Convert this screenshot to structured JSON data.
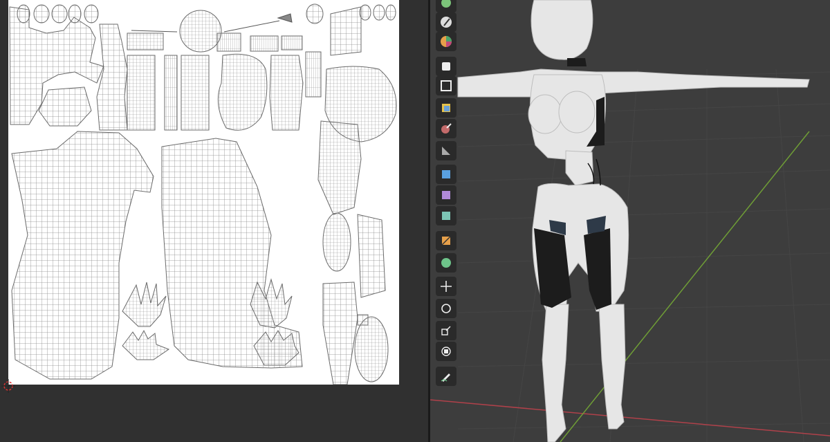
{
  "uv_editor": {
    "canvas_color": "#ffffff",
    "wire_color": "#8a8a8a",
    "background_color": "#303030"
  },
  "viewport": {
    "background_color": "#3d3d3d",
    "x_axis_color": "#b0414a",
    "y_axis_color": "#6f9e36",
    "model_color": "#e6e6e6"
  },
  "toolbar": {
    "tools": [
      {
        "name": "shader-smooth",
        "icon": "sphere-icon"
      },
      {
        "name": "paint-brush",
        "icon": "paint-brush-icon"
      },
      {
        "name": "paint-color",
        "icon": "color-wheel-icon"
      },
      {
        "name": "draw",
        "icon": "draw-icon"
      },
      {
        "name": "layer",
        "icon": "layer-icon"
      },
      {
        "name": "fill",
        "icon": "fill-icon"
      },
      {
        "name": "sample",
        "icon": "eyedropper-icon"
      },
      {
        "name": "mask",
        "icon": "mask-icon"
      },
      {
        "name": "gradient",
        "icon": "gradient-icon"
      },
      {
        "name": "smear",
        "icon": "smear-icon"
      },
      {
        "name": "clone",
        "icon": "clone-icon"
      },
      {
        "name": "blur",
        "icon": "blur-icon"
      },
      {
        "name": "soften",
        "icon": "soften-icon"
      },
      {
        "name": "move",
        "icon": "move-icon"
      },
      {
        "name": "rotate",
        "icon": "rotate-icon"
      },
      {
        "name": "scale",
        "icon": "scale-icon"
      },
      {
        "name": "transform",
        "icon": "transform-icon"
      },
      {
        "name": "annotate",
        "icon": "annotate-icon"
      }
    ]
  }
}
